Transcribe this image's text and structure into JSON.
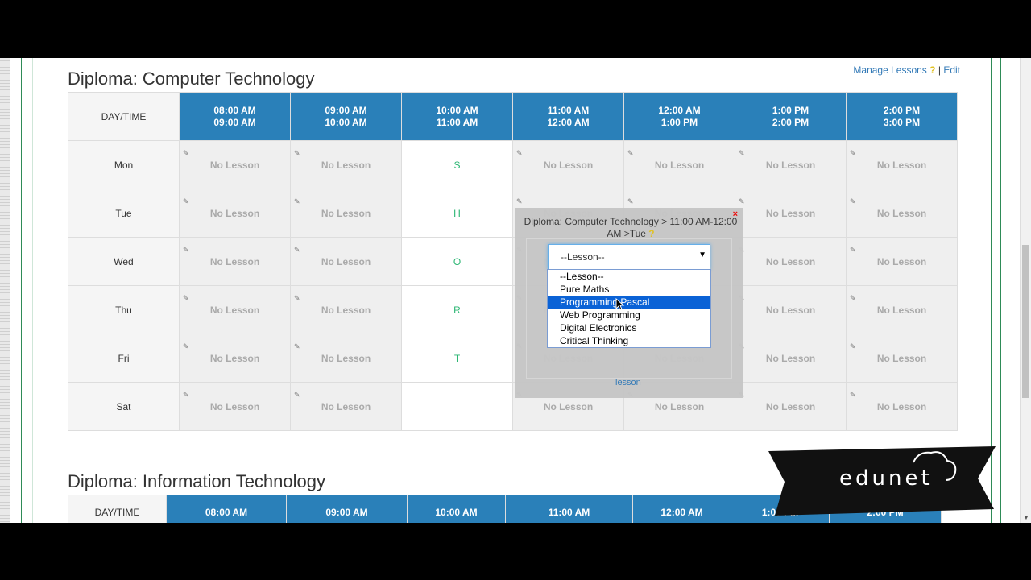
{
  "links": {
    "manage_lessons": "Manage Lessons",
    "edit": "Edit",
    "help": "?",
    "separator": "|"
  },
  "section1": {
    "title": "Diploma: Computer Technology",
    "day_time_label": "DAY/TIME",
    "slots": [
      {
        "start": "08:00 AM",
        "end": "09:00 AM"
      },
      {
        "start": "09:00 AM",
        "end": "10:00 AM"
      },
      {
        "start": "10:00 AM",
        "end": "11:00 AM"
      },
      {
        "start": "11:00 AM",
        "end": "12:00 AM"
      },
      {
        "start": "12:00 AM",
        "end": "1:00 PM"
      },
      {
        "start": "1:00 PM",
        "end": "2:00 PM"
      },
      {
        "start": "2:00 PM",
        "end": "3:00 PM"
      }
    ],
    "days": [
      "Mon",
      "Tue",
      "Wed",
      "Thu",
      "Fri",
      "Sat"
    ],
    "no_lesson": "No Lesson",
    "break_letters": [
      "S",
      "H",
      "O",
      "R",
      "T",
      ""
    ]
  },
  "section2": {
    "title": "Diploma: Information Technology",
    "day_time_label": "DAY/TIME",
    "slots": [
      "08:00 AM",
      "09:00 AM",
      "10:00 AM",
      "11:00 AM",
      "12:00 AM",
      "1:00 PM",
      "2:00 PM"
    ]
  },
  "popup": {
    "title": "Diploma: Computer Technology > 11:00 AM-12:00 AM >Tue",
    "help": "?",
    "close": "×",
    "select_value": "--Lesson--",
    "options": [
      "--Lesson--",
      "Pure Maths",
      "Programming Pascal",
      "Web Programming",
      "Digital Electronics",
      "Critical Thinking"
    ],
    "highlighted_option": "Programming Pascal",
    "link": "lesson"
  },
  "logo": {
    "text": "edunet"
  }
}
